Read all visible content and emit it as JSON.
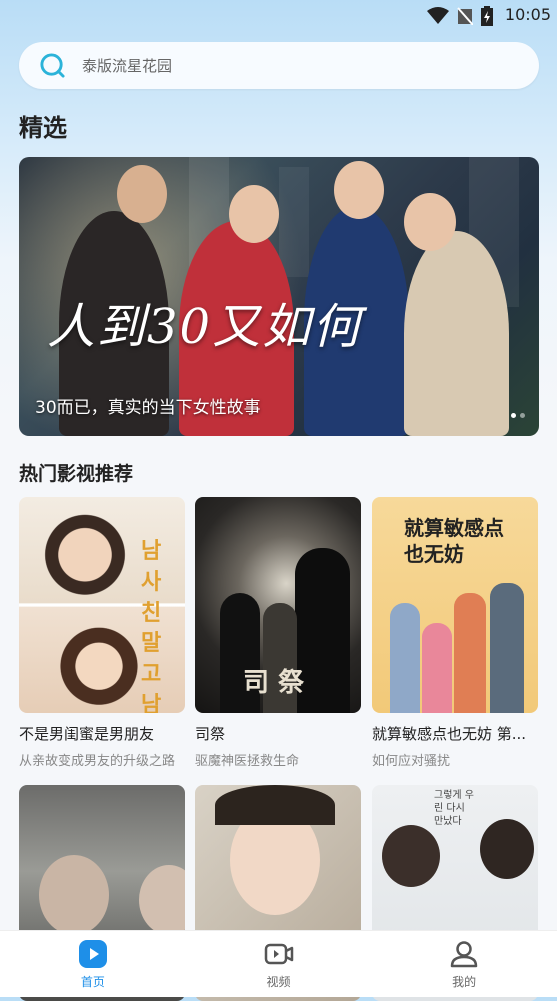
{
  "status_bar": {
    "time": "10:05"
  },
  "search": {
    "placeholder": "泰版流星花园"
  },
  "featured": {
    "title": "精选",
    "banner": {
      "caption": "30而已，真实的当下女性故事",
      "artwork_text": "人到30又如何",
      "page_count": 2,
      "active_page": 1
    }
  },
  "hot": {
    "title": "热门影视推荐",
    "items": [
      {
        "name": "不是男闺蜜是男朋友",
        "desc": "从亲故变成男友的升级之路",
        "poster_text": "남사친 말고 남친"
      },
      {
        "name": "司祭",
        "desc": "驱魔神医拯救生命",
        "poster_text": "司 祭"
      },
      {
        "name": "就算敏感点也无妨 第...",
        "desc": "如何应对骚扰",
        "poster_text": "就算敏感点也无妨"
      },
      {
        "name": "",
        "desc": "",
        "poster_text": ""
      },
      {
        "name": "",
        "desc": "",
        "poster_text": ""
      },
      {
        "name": "",
        "desc": "",
        "poster_text": "그렇게 우린 다시 만났다"
      }
    ]
  },
  "tabbar": {
    "tabs": [
      {
        "label": "首页",
        "icon": "play-icon",
        "active": true
      },
      {
        "label": "视频",
        "icon": "video-camera-icon",
        "active": false
      },
      {
        "label": "我的",
        "icon": "profile-icon",
        "active": false
      }
    ],
    "accent_color": "#1e8fe8"
  }
}
